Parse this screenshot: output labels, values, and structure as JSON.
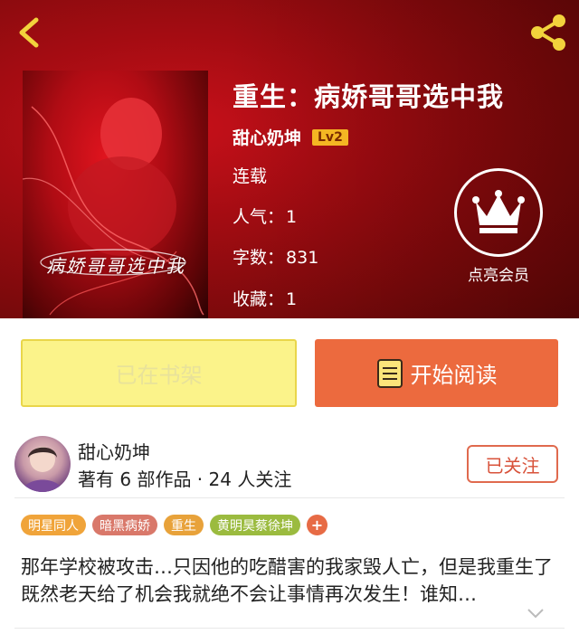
{
  "header": {
    "back_icon": "chevron-left-icon",
    "share_icon": "share-icon"
  },
  "book": {
    "title": "重生：病娇哥哥选中我",
    "cover_text": "病娇哥哥选中我",
    "author": "甜心奶坤",
    "level": "Lv2",
    "status": "连载",
    "popularity_label": "人气：",
    "popularity_value": "1",
    "wordcount_label": "字数：",
    "wordcount_value": "831",
    "favorites_label": "收藏：",
    "favorites_value": "1"
  },
  "vip": {
    "icon": "crown-icon",
    "label": "点亮会员"
  },
  "actions": {
    "shelf_label": "已在书架",
    "read_label": "开始阅读",
    "read_icon": "book-icon"
  },
  "author_card": {
    "name": "甜心奶坤",
    "stats": "著有 6 部作品 · 24 人关注",
    "follow_label": "已关注"
  },
  "tags": [
    {
      "label": "明星同人",
      "color": "#f0a43a"
    },
    {
      "label": "暗黑病娇",
      "color": "#d9786a"
    },
    {
      "label": "重生",
      "color": "#e8a23a"
    },
    {
      "label": "黄明昊蔡徐坤",
      "color": "#9bbb3f"
    }
  ],
  "tags_more": "+",
  "synopsis": "那年学校被攻击…只因他的吃醋害的我家毁人亡，但是我重生了既然老天给了机会我就绝不会让事情再次发生！谁知…",
  "colors": {
    "accent": "#ec6a3e",
    "hero_red": "#b00c14",
    "shelf_yellow": "#fbf38a",
    "lv_badge": "#f4b623"
  }
}
